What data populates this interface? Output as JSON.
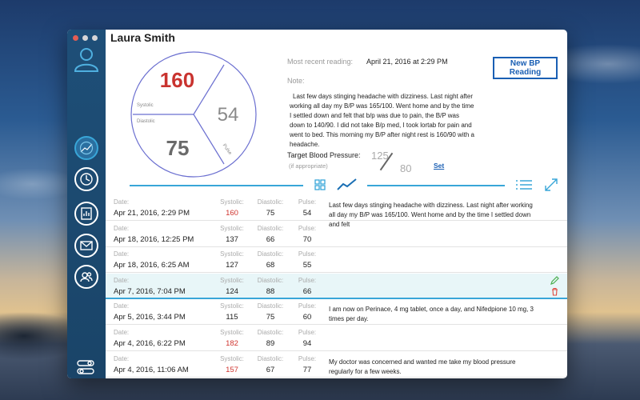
{
  "patient": {
    "name": "Laura Smith"
  },
  "gauge": {
    "systolic": "160",
    "diastolic": "75",
    "pulse": "54",
    "systolic_label": "Systolic",
    "diastolic_label": "Diastolic",
    "pulse_label": "Pulse"
  },
  "recent": {
    "label": "Most recent reading:",
    "value": "April 21, 2016 at 2:29 PM",
    "note_label": "Note:",
    "note": "Last few days stinging headache with dizziness. Last night after working all day my B/P was 165/100. Went home and by the time I settled down and felt that b/p was due to pain, the B/P was down to 140/90. I did not take B/p med, I took lortab for pain and went to bed. This morning my B/P after night rest is 160/90 with a headache."
  },
  "new_bp_button": "New BP Reading",
  "target": {
    "label": "Target Blood Pressure:",
    "sublabel": "(if appropriate)",
    "systolic": "125",
    "diastolic": "80",
    "set_label": "Set"
  },
  "toolbar": {
    "icons": [
      "grid-view-icon",
      "trend-chart-icon",
      "list-view-icon",
      "expand-icon"
    ]
  },
  "colors": {
    "accent": "#39a6d8",
    "sidebar": "#1e4f78",
    "high": "#d0352f",
    "button_blue": "#1a5fb4"
  },
  "sidebar": {
    "items": [
      "user-profile-icon",
      "chart-icon",
      "clock-icon",
      "report-icon",
      "mail-icon",
      "contacts-icon",
      "settings-toggle-icon"
    ]
  },
  "table": {
    "labels": {
      "date": "Date:",
      "systolic": "Systolic:",
      "diastolic": "Diastolic:",
      "pulse": "Pulse:"
    },
    "rows": [
      {
        "date": "Apr 21, 2016, 2:29 PM",
        "systolic": "160",
        "diastolic": "75",
        "pulse": "54",
        "high": true,
        "note": "Last few days stinging headache with dizziness. Last night after working all day my B/P was 165/100. Went home and by the time I settled down and felt"
      },
      {
        "date": "Apr 18, 2016, 12:25 PM",
        "systolic": "137",
        "diastolic": "66",
        "pulse": "70",
        "high": false,
        "note": ""
      },
      {
        "date": "Apr 18, 2016, 6:25 AM",
        "systolic": "127",
        "diastolic": "68",
        "pulse": "55",
        "high": false,
        "note": ""
      },
      {
        "date": "Apr 7, 2016, 7:04 PM",
        "systolic": "124",
        "diastolic": "88",
        "pulse": "66",
        "high": false,
        "note": ""
      },
      {
        "date": "Apr 5, 2016, 3:44 PM",
        "systolic": "115",
        "diastolic": "75",
        "pulse": "60",
        "high": false,
        "note": "I am now on Perinace, 4 mg tablet, once a day, and Nifedpione 10 mg, 3 times per day."
      },
      {
        "date": "Apr 4, 2016, 6:22 PM",
        "systolic": "182",
        "diastolic": "89",
        "pulse": "94",
        "high": true,
        "note": ""
      },
      {
        "date": "Apr 4, 2016, 11:06 AM",
        "systolic": "157",
        "diastolic": "67",
        "pulse": "77",
        "high": true,
        "note": "My doctor was concerned and wanted me take my blood pressure regularly for a few weeks."
      }
    ]
  }
}
